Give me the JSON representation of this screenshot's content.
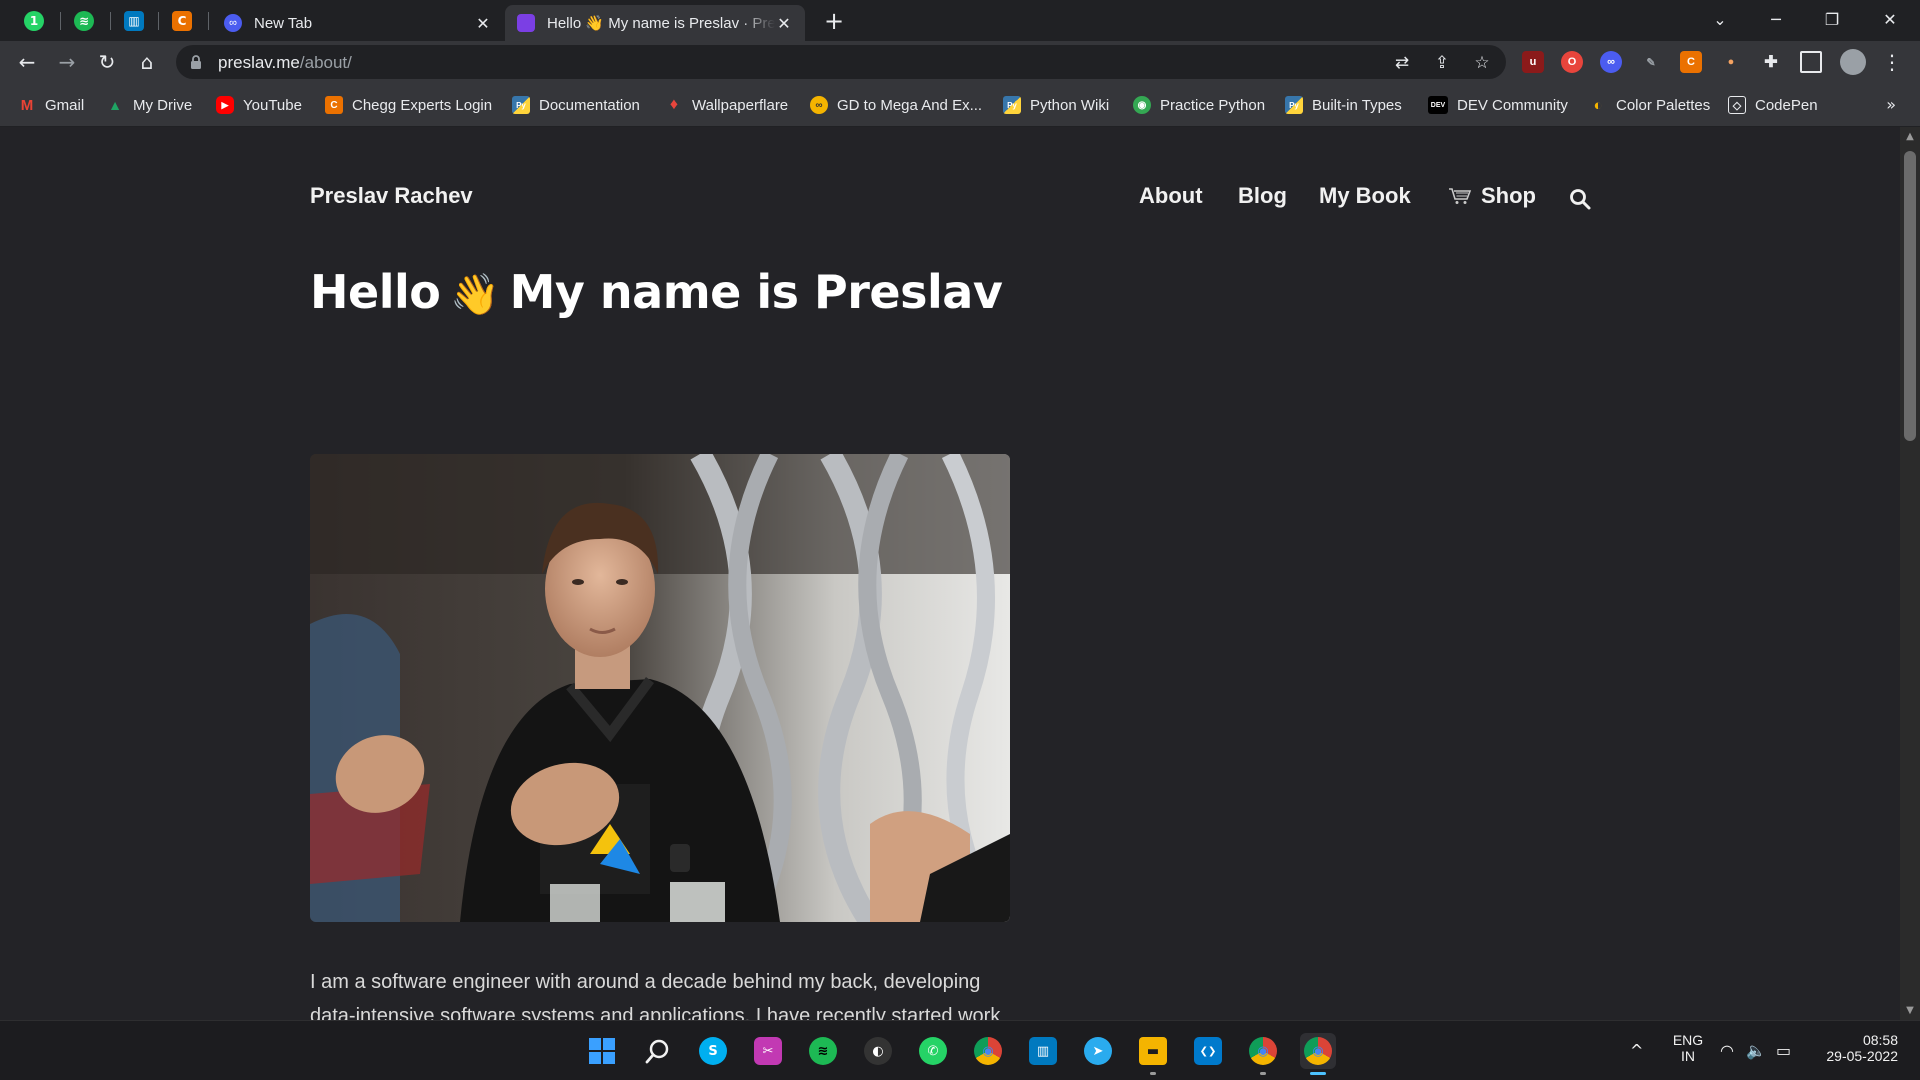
{
  "tabs": {
    "pinned": [
      {
        "icon": "whatsapp-icon",
        "color": "#25D366",
        "glyph": "1"
      },
      {
        "icon": "spotify-icon",
        "color": "#1DB954",
        "glyph": "≋"
      },
      {
        "icon": "trello-icon",
        "color": "#0079BF",
        "glyph": "▥"
      },
      {
        "icon": "chegg-icon",
        "color": "#EB7100",
        "glyph": "C"
      }
    ],
    "items": [
      {
        "title": "New Tab",
        "close": "✕"
      },
      {
        "title": "Hello 👋 My name is Preslav · Preslav Rachev",
        "close": "✕"
      }
    ],
    "new_tab": "+"
  },
  "window": {
    "dropdown": "⌄",
    "minimize": "─",
    "restore": "❐",
    "close": "✕"
  },
  "toolbar": {
    "back": "←",
    "forward": "→",
    "reload": "↻",
    "home": "⌂",
    "url_host": "preslav.me",
    "url_path": "/about/",
    "translate": "⇄",
    "share": "⇪",
    "bookmark_star": "☆",
    "menu": "⋮"
  },
  "bookmarks": [
    {
      "label": "Gmail",
      "icon": "gmail-icon",
      "color": "#EA4335",
      "glyph": "M"
    },
    {
      "label": "My Drive",
      "icon": "drive-icon",
      "color": "#1FA463",
      "glyph": "▲"
    },
    {
      "label": "YouTube",
      "icon": "youtube-icon",
      "color": "#FF0000",
      "glyph": "▶"
    },
    {
      "label": "Chegg Experts Login",
      "icon": "chegg-icon",
      "color": "#EB7100",
      "glyph": "C"
    },
    {
      "label": "Documentation",
      "icon": "python-icon",
      "color": "#3776AB",
      "glyph": "Py"
    },
    {
      "label": "Wallpaperflare",
      "icon": "wallpaperflare-icon",
      "color": "#E8453C",
      "glyph": "♦"
    },
    {
      "label": "GD to Mega And Ex...",
      "icon": "gd-icon",
      "color": "#F4B400",
      "glyph": "∞"
    },
    {
      "label": "Python Wiki",
      "icon": "python-icon",
      "color": "#3776AB",
      "glyph": "Py"
    },
    {
      "label": "Practice Python",
      "icon": "practice-python-icon",
      "color": "#34A853",
      "glyph": "◉"
    },
    {
      "label": "Built-in Types",
      "icon": "python-icon",
      "color": "#3776AB",
      "glyph": "Py"
    },
    {
      "label": "DEV Community",
      "icon": "dev-icon",
      "color": "#000000",
      "glyph": "DEV"
    },
    {
      "label": "Color Palettes",
      "icon": "palette-icon",
      "color": "#E91E63",
      "glyph": "◐"
    },
    {
      "label": "CodePen",
      "icon": "codepen-icon",
      "color": "#111111",
      "glyph": "◇"
    }
  ],
  "bookmarks_more": "»",
  "site": {
    "name": "Preslav Rachev",
    "nav": [
      "About",
      "Blog",
      "My Book",
      "Shop"
    ],
    "hero_pre": "Hello",
    "hero_emoji": "👋",
    "hero_post": "My name is Preslav",
    "bio": "I am a software engineer with around a decade behind my back, developing data-intensive software systems and applications. I have recently started work"
  },
  "taskbar": {
    "apps": [
      {
        "name": "windows-start-icon",
        "color": "#0078D4",
        "glyph": "⊞"
      },
      {
        "name": "search-icon",
        "color": "transparent",
        "glyph": "⌕"
      },
      {
        "name": "skype-icon",
        "color": "#00AFF0",
        "glyph": "S"
      },
      {
        "name": "snipping-tool-icon",
        "color": "#C239B3",
        "glyph": "✂"
      },
      {
        "name": "spotify-icon",
        "color": "#1DB954",
        "glyph": "≋"
      },
      {
        "name": "alienware-icon",
        "color": "#333333",
        "glyph": "◐"
      },
      {
        "name": "whatsapp-icon",
        "color": "#25D366",
        "glyph": "✆"
      },
      {
        "name": "chrome-icon",
        "color": "#DB4437",
        "glyph": "◉"
      },
      {
        "name": "trello-icon",
        "color": "#0079BF",
        "glyph": "▥"
      },
      {
        "name": "telegram-icon",
        "color": "#2AABEE",
        "glyph": "➤"
      },
      {
        "name": "file-explorer-icon",
        "color": "#F4B400",
        "glyph": "▬"
      },
      {
        "name": "vscode-icon",
        "color": "#007ACC",
        "glyph": "❮❯"
      },
      {
        "name": "chrome-profile-icon",
        "color": "#DB4437",
        "glyph": "◉"
      },
      {
        "name": "chrome-active-icon",
        "color": "#DB4437",
        "glyph": "◉"
      }
    ],
    "tray": {
      "chevron": "^",
      "lang_top": "ENG",
      "lang_bottom": "IN",
      "wifi": "◠",
      "volume": "🔈",
      "battery": "▭",
      "time": "08:58",
      "date": "29-05-2022"
    }
  }
}
